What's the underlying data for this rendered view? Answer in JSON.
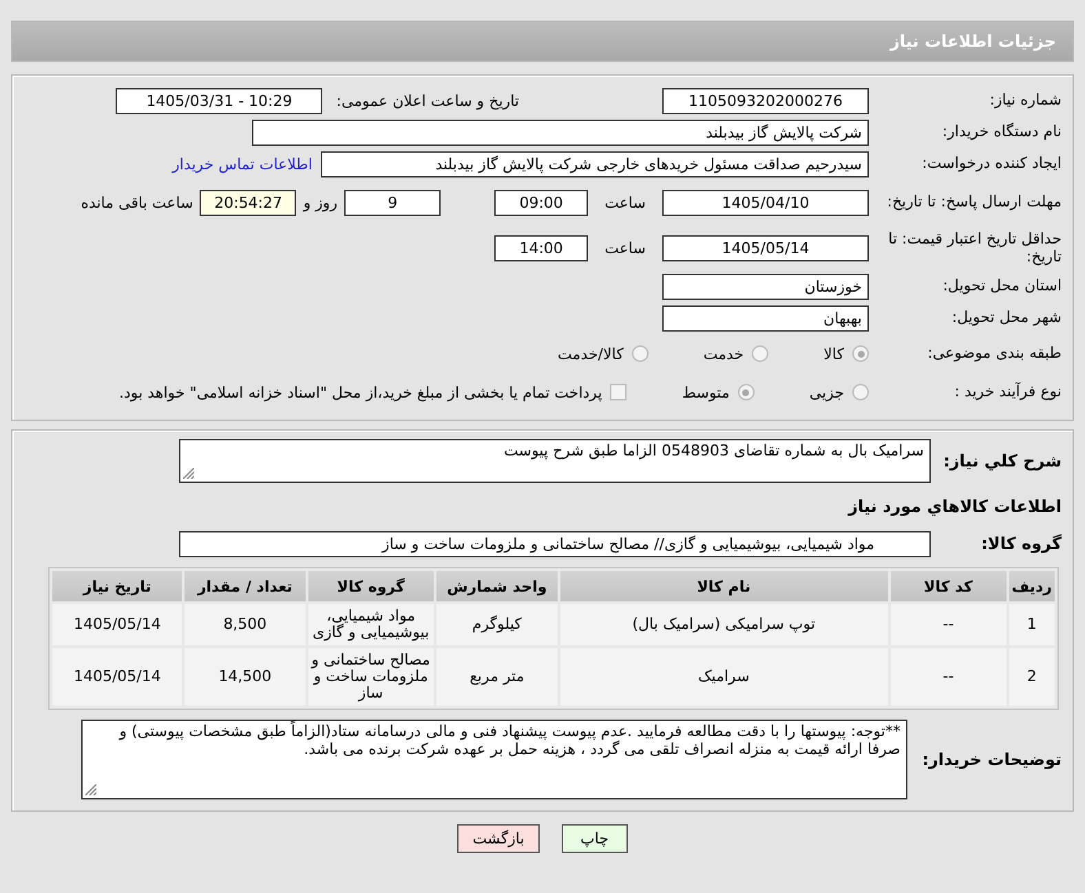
{
  "header": {
    "title": "جزئیات اطلاعات نیاز"
  },
  "need_number": {
    "label": "شماره نیاز:",
    "value": "1105093202000276"
  },
  "announce": {
    "label": "تاریخ و ساعت اعلان عمومی:",
    "value": "1405/03/31 - 10:29"
  },
  "buyer": {
    "label": "نام دستگاه خریدار:",
    "value": "شرکت پالایش گاز بیدبلند"
  },
  "creator": {
    "label": "ایجاد کننده درخواست:",
    "value": "سیدرحیم صداقت مسئول خریدهای خارجی شرکت پالایش گاز بیدبلند",
    "link": "اطلاعات تماس خریدار"
  },
  "deadline": {
    "label": "مهلت ارسال پاسخ: تا تاریخ:",
    "date": "1405/04/10",
    "time_label": "ساعت",
    "time": "09:00",
    "days": "9",
    "days_label": "روز و",
    "remaining": "20:54:27",
    "remaining_label": "ساعت باقی مانده"
  },
  "price_validity": {
    "label": "حداقل تاریخ اعتبار قیمت: تا تاریخ:",
    "date": "1405/05/14",
    "time_label": "ساعت",
    "time": "14:00"
  },
  "province": {
    "label": "استان محل تحویل:",
    "value": "خوزستان"
  },
  "city": {
    "label": "شهر محل تحویل:",
    "value": "بهبهان"
  },
  "category": {
    "label": "طبقه بندی موضوعی:",
    "options": [
      {
        "label": "کالا",
        "selected": true
      },
      {
        "label": "خدمت",
        "selected": false
      },
      {
        "label": "کالا/خدمت",
        "selected": false
      }
    ]
  },
  "process": {
    "label": "نوع فرآیند خرید :",
    "options": [
      {
        "label": "جزیی",
        "selected": false
      },
      {
        "label": "متوسط",
        "selected": true
      }
    ],
    "payment": {
      "label": "پرداخت تمام یا بخشی از مبلغ خرید،از محل \"اسناد خزانه اسلامی\" خواهد بود.",
      "checked": false
    }
  },
  "description": {
    "label": "شرح کلي نیاز:",
    "value": "سرامیک بال  به شماره تقاضای 0548903  الزاما طبق شرح پیوست"
  },
  "goods_heading": "اطلاعات کالاهاي مورد نیاز",
  "goods_group": {
    "label": "گروه کالا:",
    "value": "مواد شیمیایی، بیوشیمیایی و  گازی// مصالح ساختمانی و ملزومات ساخت و ساز"
  },
  "table": {
    "columns": [
      "ردیف",
      "کد کالا",
      "نام کالا",
      "واحد شمارش",
      "گروه کالا",
      "تعداد / مقدار",
      "تاریخ نیاز"
    ],
    "rows": [
      [
        "1",
        "--",
        "توپ سرامیکی (سرامیک بال)",
        "کیلوگرم",
        "مواد شیمیایی، بیوشیمیایی و گازی",
        "8,500",
        "1405/05/14"
      ],
      [
        "2",
        "--",
        "سرامیک",
        "متر مربع",
        "مصالح ساختمانی و ملزومات ساخت و ساز",
        "14,500",
        "1405/05/14"
      ]
    ]
  },
  "buyer_notes": {
    "label": "توضیحات خریدار:",
    "value": "**توجه: پیوستها را با دقت مطالعه فرمایید .عدم پیوست پیشنهاد فنی و مالی درسامانه ستاد(الزاماً طبق مشخصات پیوستی) و صرفا ارائه قیمت به منزله انصراف تلقی می گردد ، هزینه حمل بر عهده شرکت برنده می باشد."
  },
  "buttons": [
    {
      "label": "چاپ",
      "kind": "print"
    },
    {
      "label": "بازگشت",
      "kind": "back"
    }
  ]
}
